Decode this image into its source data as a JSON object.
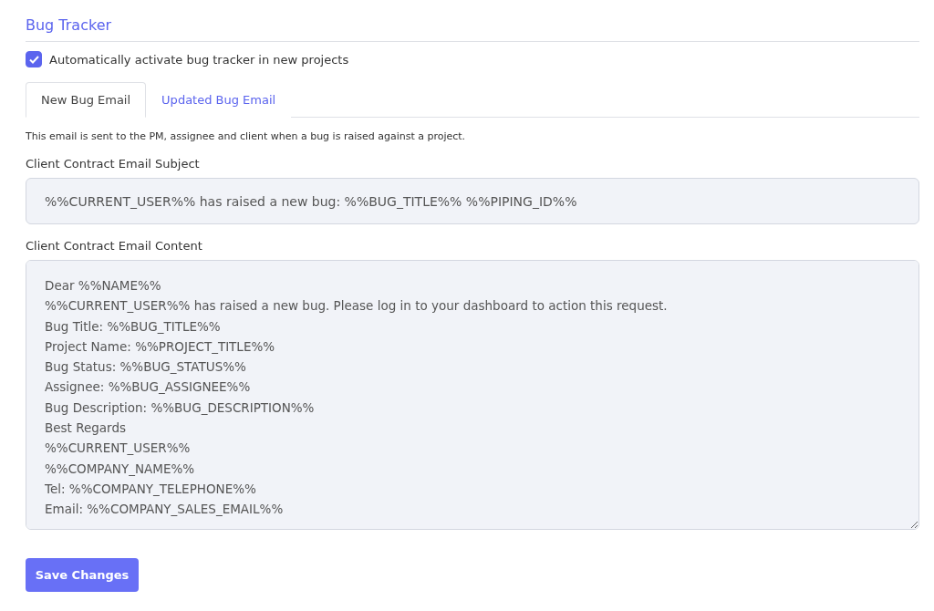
{
  "section": {
    "title": "Bug Tracker"
  },
  "auto_activate": {
    "label": "Automatically activate bug tracker in new projects",
    "checked": true
  },
  "tabs": [
    {
      "label": "New Bug Email",
      "selected": true
    },
    {
      "label": "Updated Bug Email",
      "selected": false
    }
  ],
  "description": "This email is sent to the PM, assignee and client when a bug is raised against a project.",
  "subject": {
    "label": "Client Contract Email Subject",
    "value": "%%CURRENT_USER%% has raised a new bug: %%BUG_TITLE%% %%PIPING_ID%%"
  },
  "content": {
    "label": "Client Contract Email Content",
    "lines": [
      "Dear %%NAME%%",
      "%%CURRENT_USER%% has raised a new bug. Please log in to your dashboard to action this request.",
      "Bug Title: %%BUG_TITLE%%",
      "Project Name: %%PROJECT_TITLE%%",
      "Bug Status: %%BUG_STATUS%%",
      "Assignee: %%BUG_ASSIGNEE%%",
      "Bug Description: %%BUG_DESCRIPTION%%",
      "Best Regards",
      "%%CURRENT_USER%%",
      "%%COMPANY_NAME%%",
      "Tel: %%COMPANY_TELEPHONE%%",
      "Email: %%COMPANY_SALES_EMAIL%%"
    ]
  },
  "save_button": "Save Changes"
}
